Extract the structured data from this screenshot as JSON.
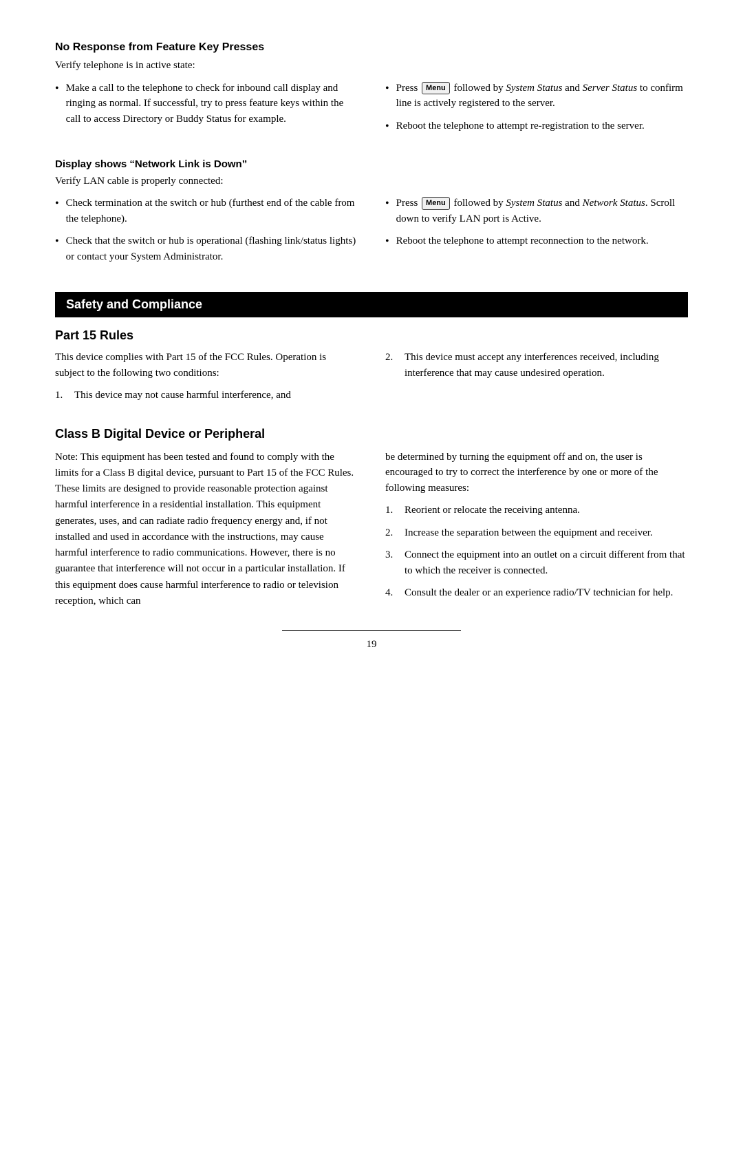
{
  "page": {
    "page_number": "19"
  },
  "no_response_section": {
    "heading": "No Response from Feature Key Presses",
    "intro": "Verify telephone is in active state:",
    "left_bullets": [
      "Make a call to the telephone to check for inbound call display and ringing as normal.  If successful, try to press feature keys within the call to access Directory or Buddy Status for example."
    ],
    "right_bullets": [
      "followed by System Status and Server Status to confirm line is actively registered to the server.",
      "Reboot the telephone to attempt re-registration to the server."
    ]
  },
  "display_section": {
    "heading": "Display shows “Network Link is Down”",
    "intro": "Verify LAN cable is properly connected:",
    "left_bullets": [
      "Check termination at the switch or hub (furthest end of the cable from the telephone).",
      "Check that the switch or hub is operational (flashing link/status lights) or contact your System Administrator."
    ],
    "right_bullets": [
      "followed by System Status and Network Status.  Scroll down to verify LAN port is Active.",
      "Reboot the telephone to attempt reconnection to the network."
    ]
  },
  "safety_banner": {
    "label": "Safety and Compliance"
  },
  "part15_section": {
    "heading": "Part 15 Rules",
    "intro": "This device complies with Part 15 of the FCC Rules.  Operation is subject to the following two conditions:",
    "left_items": [
      "This device may not cause harmful interference, and"
    ],
    "right_items": [
      "This device must accept any interferences received, including interference that may cause undesired operation."
    ]
  },
  "classb_section": {
    "heading": "Class B Digital Device or Peripheral",
    "left_text": "Note:  This equipment has been tested and found to comply with the limits for a Class B digital device, pursuant to Part 15 of the FCC Rules.  These limits are designed to provide reasonable protection against harmful interference in a residential installation.  This equipment generates, uses, and can radiate radio frequency energy and, if not installed and used in accordance with the instructions, may cause harmful interference to radio communications.  However, there is no guarantee that interference will not occur in a particular installation.  If this equipment does cause harmful interference to radio or television reception, which can",
    "right_intro": "be determined by turning the equipment off and on, the user is encouraged to try to correct the interference by one or more of the following measures:",
    "right_items": [
      "Reorient or relocate the receiving antenna.",
      "Increase the separation between the equipment and receiver.",
      "Connect the equipment into an outlet on a circuit different from that to which the receiver is connected.",
      "Consult the dealer or an experience radio/TV technician for help."
    ]
  },
  "keys": {
    "menu_label": "Menu",
    "press_label": "Press"
  }
}
